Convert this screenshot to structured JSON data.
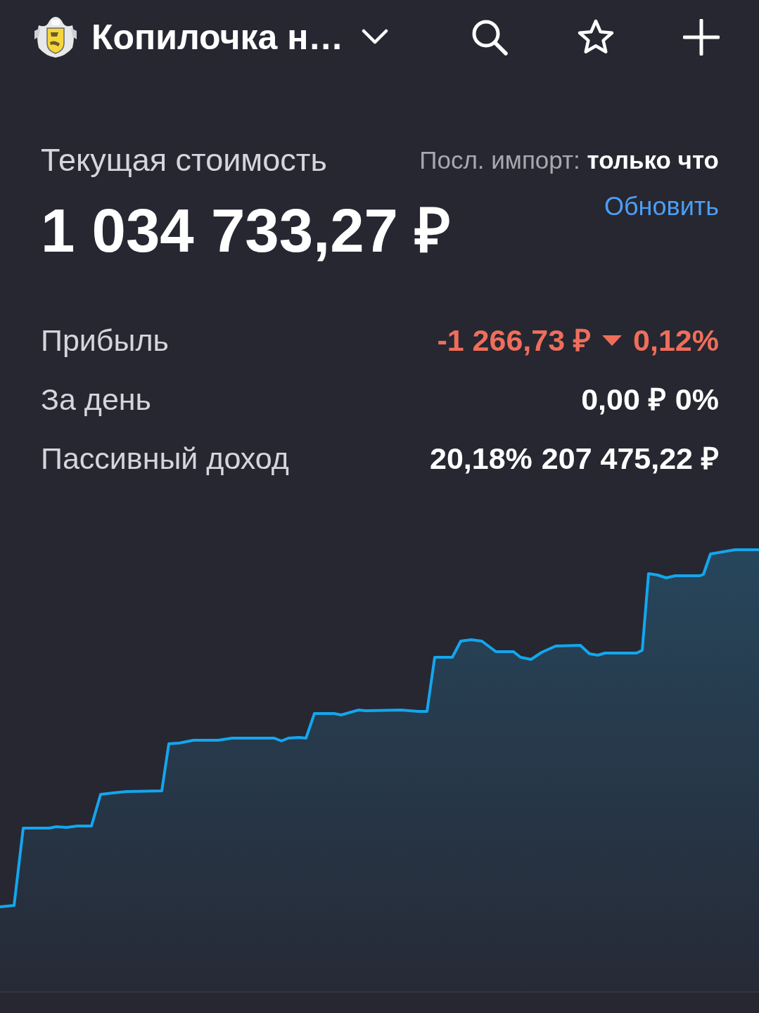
{
  "header": {
    "title": "Копилочка н…"
  },
  "summary": {
    "label": "Текущая стоимость",
    "value": "1 034 733,27 ₽",
    "import_status": "Посл. импорт: **только что**",
    "refresh_link": "Обновить"
  },
  "stats": [
    {
      "label": "Прибыль",
      "falling": true,
      "values": [
        "-1 266,73 ₽",
        "0,12%"
      ]
    },
    {
      "label": "За день",
      "falling": false,
      "values": [
        "0,00 ₽",
        "0%"
      ]
    },
    {
      "label": "Пассивный доход",
      "falling": false,
      "values": [
        "20,18%",
        "207 475,22 ₽"
      ]
    }
  ]
}
